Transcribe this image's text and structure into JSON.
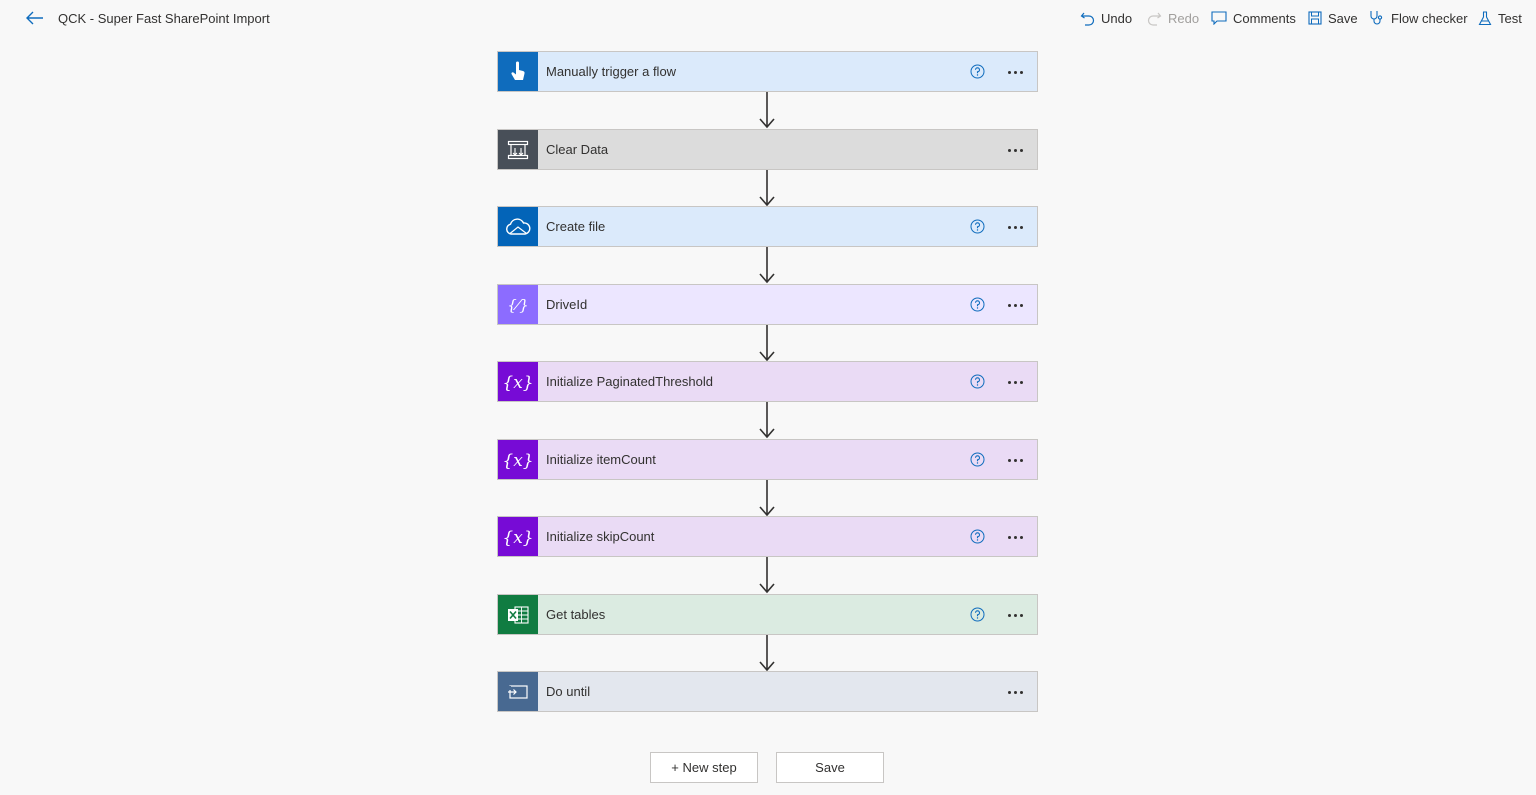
{
  "header": {
    "title": "QCK - Super Fast SharePoint Import",
    "commands": {
      "undo": "Undo",
      "redo": "Redo",
      "comments": "Comments",
      "save": "Save",
      "flow_checker": "Flow checker",
      "test": "Test"
    }
  },
  "steps": [
    {
      "label": "Manually trigger a flow",
      "icon": "touch-trigger-icon",
      "icon_bg": "#0f6cbd",
      "card_bg": "#dbeafb",
      "help": true
    },
    {
      "label": "Clear Data",
      "icon": "scope-icon",
      "icon_bg": "#484f58",
      "card_bg": "#dcdcdc",
      "help": false
    },
    {
      "label": "Create file",
      "icon": "onedrive-icon",
      "icon_bg": "#0364b8",
      "card_bg": "#dbeafb",
      "help": true
    },
    {
      "label": "DriveId",
      "icon": "compose-icon",
      "icon_bg": "#8c6cff",
      "card_bg": "#ece6ff",
      "help": true
    },
    {
      "label": "Initialize PaginatedThreshold",
      "icon": "variable-icon",
      "icon_bg": "#770bd6",
      "card_bg": "#eadbf5",
      "help": true
    },
    {
      "label": "Initialize itemCount",
      "icon": "variable-icon",
      "icon_bg": "#770bd6",
      "card_bg": "#eadbf5",
      "help": true
    },
    {
      "label": "Initialize skipCount",
      "icon": "variable-icon",
      "icon_bg": "#770bd6",
      "card_bg": "#eadbf5",
      "help": true
    },
    {
      "label": "Get tables",
      "icon": "excel-icon",
      "icon_bg": "#107c41",
      "card_bg": "#dbebe1",
      "help": true
    },
    {
      "label": "Do until",
      "icon": "loop-icon",
      "icon_bg": "#486991",
      "card_bg": "#e3e7ee",
      "help": false
    }
  ],
  "footer": {
    "new_step": "+ New step",
    "save": "Save"
  }
}
